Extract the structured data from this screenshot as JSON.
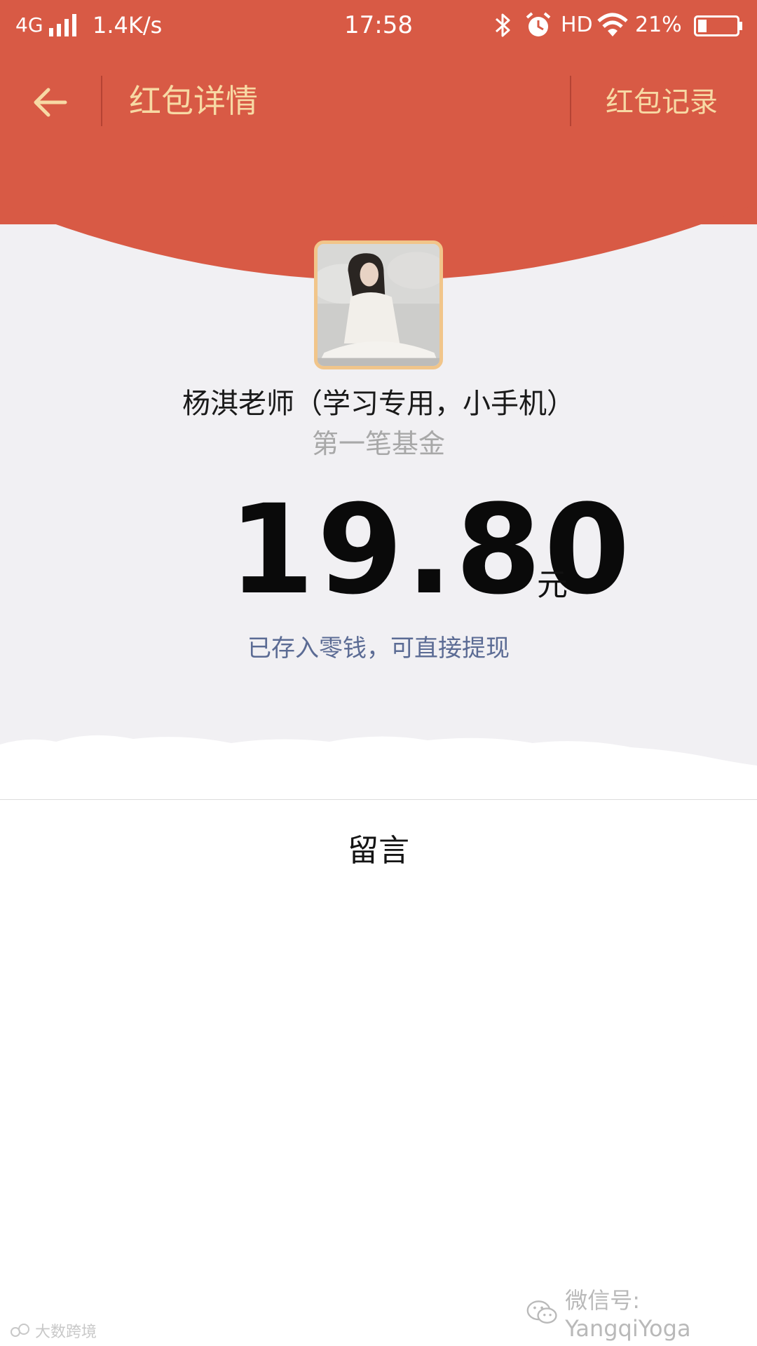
{
  "status_bar": {
    "network": "4G",
    "speed": "1.4K/s",
    "time": "17:58",
    "hd": "HD",
    "battery": "21%",
    "icons": [
      "signal-icon",
      "bluetooth-icon",
      "alarm-icon",
      "wifi-icon",
      "battery-icon"
    ]
  },
  "header": {
    "back_icon": "arrow-left-icon",
    "title": "红包详情",
    "records_link": "红包记录"
  },
  "packet": {
    "sender": "杨淇老师（学习专用，小手机）",
    "blessing": "第一笔基金",
    "amount": "19.80",
    "unit": "元",
    "status_link": "已存入零钱，可直接提现"
  },
  "comments": {
    "label": "留言"
  },
  "watermarks": {
    "left": "大数跨境",
    "right": "微信号: YangqiYoga"
  },
  "colors": {
    "header_red": "#d85a45",
    "title_gold": "#f7d9a4",
    "link_blue": "#5b6b94",
    "background_gray": "#f1f0f3"
  }
}
